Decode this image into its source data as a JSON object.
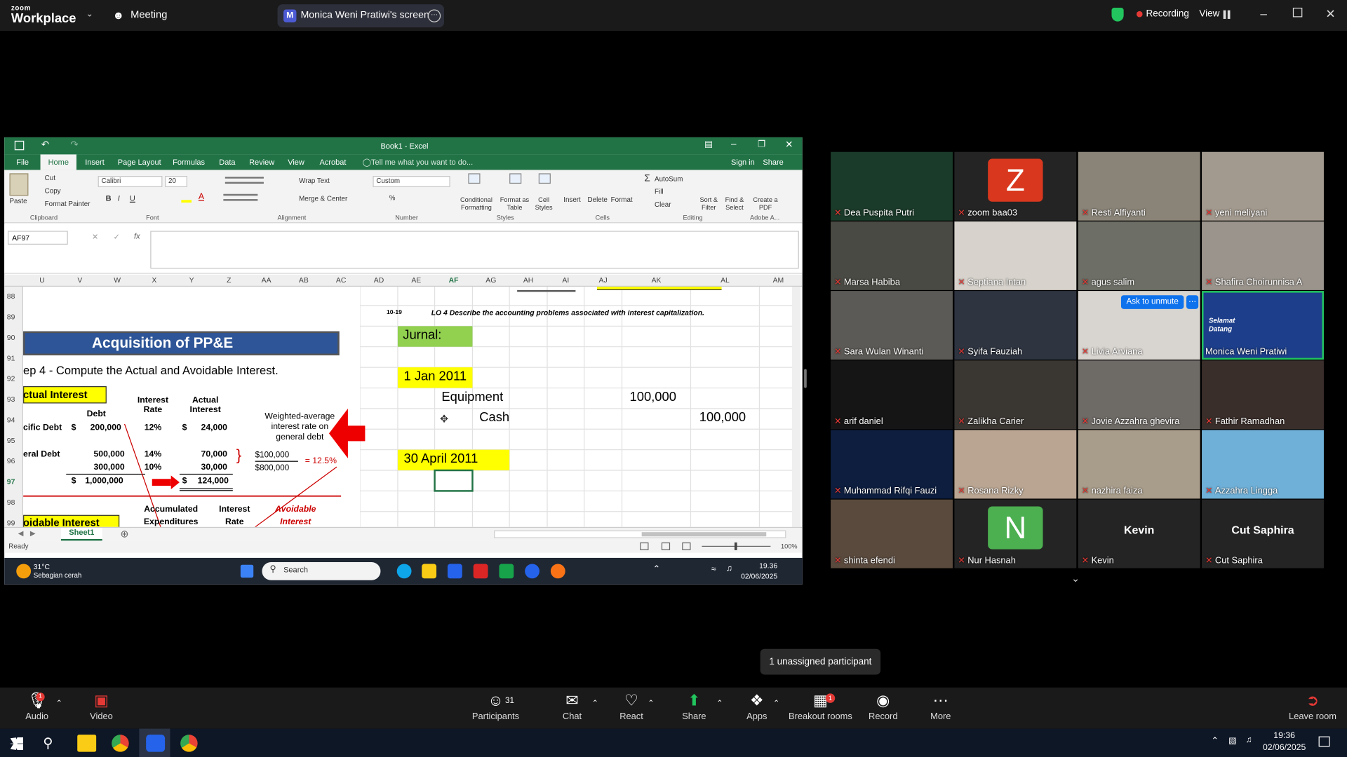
{
  "zoom": {
    "logo_small": "zoom",
    "logo_big": "Workplace",
    "meeting_label": "Meeting",
    "share_owner_initial": "M",
    "share_label": "Monica Weni Pratiwi's screen",
    "recording_label": "Recording",
    "view_label": "View"
  },
  "excel": {
    "title": "Book1 - Excel",
    "tabs": [
      "File",
      "Home",
      "Insert",
      "Page Layout",
      "Formulas",
      "Data",
      "Review",
      "View",
      "Acrobat"
    ],
    "tell_me": "Tell me what you want to do...",
    "sign_in": "Sign in",
    "share": "Share",
    "clipboard": {
      "paste": "Paste",
      "cut": "Cut",
      "copy": "Copy",
      "format_painter": "Format Painter",
      "group": "Clipboard"
    },
    "font": {
      "name": "Calibri",
      "size": "20",
      "group": "Font"
    },
    "alignment": {
      "wrap": "Wrap Text",
      "merge": "Merge & Center",
      "group": "Alignment"
    },
    "number": {
      "format": "Custom",
      "group": "Number"
    },
    "styles": {
      "cond": "Conditional Formatting",
      "table": "Format as Table",
      "cell": "Cell Styles",
      "group": "Styles"
    },
    "cells": {
      "insert": "Insert",
      "delete": "Delete",
      "format": "Format",
      "group": "Cells"
    },
    "editing": {
      "autosum": "AutoSum",
      "fill": "Fill",
      "clear": "Clear",
      "sort": "Sort & Filter",
      "find": "Find & Select",
      "group": "Editing"
    },
    "adobe": {
      "create": "Create a PDF",
      "group": "Adobe A..."
    },
    "name_box": "AF97",
    "columns": [
      "U",
      "V",
      "W",
      "X",
      "Y",
      "Z",
      "AA",
      "AB",
      "AC",
      "AD",
      "AE",
      "AF",
      "AG",
      "AH",
      "AI",
      "AJ",
      "AK",
      "AL",
      "AM"
    ],
    "rows": [
      "88",
      "89",
      "90",
      "91",
      "92",
      "93",
      "94",
      "95",
      "96",
      "97",
      "98",
      "99"
    ],
    "slide": {
      "title": "Acquisition of PP&E",
      "step": "ep 4 - Compute the Actual and Avoidable Interest.",
      "actual_interest": "ctual Interest",
      "col_interest_rate": "Interest Rate",
      "col_actual_interest": "Actual Interest",
      "col_debt": "Debt",
      "specific_debt_label": "cific Debt",
      "specific_debt": "200,000",
      "specific_rate": "12%",
      "specific_int": "24,000",
      "general_debt_label": "eral Debt",
      "g1_debt": "500,000",
      "g1_rate": "14%",
      "g1_int": "70,000",
      "g2_debt": "300,000",
      "g2_rate": "10%",
      "g2_int": "30,000",
      "total_debt": "1,000,000",
      "total_int": "124,000",
      "dollar": "$",
      "weighted_note": "Weighted-average interest rate on general debt",
      "frac_num": "$100,000",
      "frac_den": "$800,000",
      "equals": "= 12.5%",
      "avoidable": "oidable Interest",
      "col_accum": "Accumulated Expenditures",
      "col_int_rate2": "Interest Rate",
      "col_avoidable": "Avoidable Interest"
    },
    "lo_text": "LO 4  Describe the accounting problems associated with interest capitalization.",
    "lo_num": "10-19",
    "cells_data": {
      "jurnal": "Jurnal:",
      "date1": "1 Jan 2011",
      "equipment": "Equipment",
      "equipment_amt": "100,000",
      "cash": "Cash",
      "cash_amt": "100,000",
      "date2": "30 April 2011"
    },
    "sheet_tab": "Sheet1",
    "status": "Ready",
    "zoom_pct": "100%"
  },
  "inner_taskbar": {
    "weather_temp": "31°C",
    "weather_desc": "Sebagian cerah",
    "search": "Search",
    "time": "19.36",
    "date": "02/06/2025"
  },
  "participants": [
    {
      "name": "Dea Puspita Putri",
      "muted": true,
      "bg": "#1b3b2a"
    },
    {
      "name": "zoom baa03",
      "muted": true,
      "bg": "#242424",
      "initial": "Z",
      "initial_color": "#d9381e"
    },
    {
      "name": "Resti Alfiyanti",
      "muted": true,
      "bg": "#8a8478"
    },
    {
      "name": "yeni meliyani",
      "muted": true,
      "bg": "#a39a8f"
    },
    {
      "name": "Marsa Habiba",
      "muted": true,
      "bg": "#4a4a44"
    },
    {
      "name": "Septiana Intan",
      "muted": true,
      "bg": "#d7d3cc"
    },
    {
      "name": "agus salim",
      "muted": true,
      "bg": "#6d6f66"
    },
    {
      "name": "Shafira Choirunnisa A",
      "muted": true,
      "bg": "#9a948c"
    },
    {
      "name": "Sara Wulan Winanti",
      "muted": true,
      "bg": "#5c5a56"
    },
    {
      "name": "Syifa Fauziah",
      "muted": true,
      "bg": "#2e3440"
    },
    {
      "name": "Livia Arviana",
      "muted": true,
      "bg": "#d8d4cf",
      "ask": "Ask to unmute"
    },
    {
      "name": "Monica Weni Pratiwi",
      "muted": false,
      "bg": "#1d3e8a",
      "active": true,
      "slide_text": "Selamat Datang"
    },
    {
      "name": "arif daniel",
      "muted": true,
      "bg": "#151515"
    },
    {
      "name": "Zalikha Carier",
      "muted": true,
      "bg": "#3a3632"
    },
    {
      "name": "Jovie Azzahra ghevira",
      "muted": true,
      "bg": "#6e6a66"
    },
    {
      "name": "Fathir Ramadhan",
      "muted": true,
      "bg": "#3a2e2a"
    },
    {
      "name": "Muhammad Rifqi Fauzi",
      "muted": true,
      "bg": "#0d1e3f"
    },
    {
      "name": "Rosana Rizky",
      "muted": true,
      "bg": "#b9a592"
    },
    {
      "name": "nazhira faiza",
      "muted": true,
      "bg": "#a89c8a"
    },
    {
      "name": "Azzahra Lingga",
      "muted": true,
      "bg": "#6fb0d8"
    },
    {
      "name": "shinta efendi",
      "muted": true,
      "bg": "#5a4a3e"
    },
    {
      "name": "Nur Hasnah",
      "muted": true,
      "bg": "#242424",
      "initial": "N",
      "initial_color": "#4caf50"
    },
    {
      "name": "Kevin",
      "muted": true,
      "bg": "#242424",
      "bigname": "Kevin"
    },
    {
      "name": "Cut Saphira",
      "muted": true,
      "bg": "#242424",
      "bigname": "Cut Saphira"
    }
  ],
  "tooltip": "1 unassigned participant",
  "toolbar": {
    "audio": "Audio",
    "video": "Video",
    "participants": "Participants",
    "participants_count": "31",
    "chat": "Chat",
    "react": "React",
    "share": "Share",
    "apps": "Apps",
    "breakout": "Breakout rooms",
    "breakout_badge": "1",
    "audio_badge": "1",
    "record": "Record",
    "more": "More",
    "leave": "Leave room"
  },
  "win_taskbar": {
    "time": "19:36",
    "date": "02/06/2025"
  }
}
